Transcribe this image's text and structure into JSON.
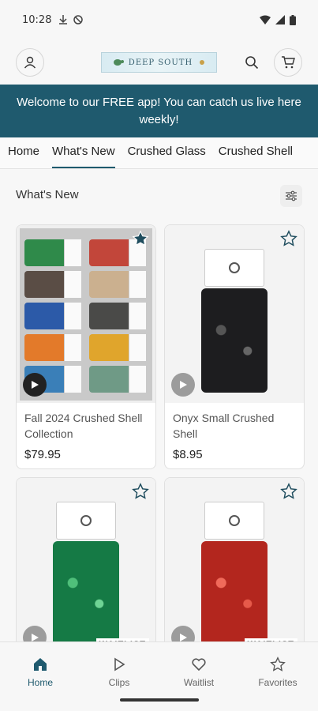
{
  "status_bar": {
    "time": "10:28"
  },
  "header": {
    "logo_text": "DEEP SOUTH"
  },
  "banner": {
    "text": "Welcome to our FREE app! You can catch us live here weekly!"
  },
  "tabs": [
    {
      "label": "Home",
      "active": false
    },
    {
      "label": "What's New",
      "active": true
    },
    {
      "label": "Crushed Glass",
      "active": false
    },
    {
      "label": "Crushed Shell",
      "active": false
    }
  ],
  "section": {
    "title": "What's New"
  },
  "products": [
    {
      "name": "Fall 2024 Crushed Shell Collection",
      "price": "$79.95",
      "favorited": true,
      "badge": ""
    },
    {
      "name": "Onyx Small Crushed Shell",
      "price": "$8.95",
      "favorited": false,
      "badge": ""
    },
    {
      "name": "",
      "price": "",
      "favorited": false,
      "badge": "WAITLIST"
    },
    {
      "name": "",
      "price": "",
      "favorited": false,
      "badge": "WAITLIST"
    }
  ],
  "bottom_nav": [
    {
      "label": "Home",
      "icon": "home-icon",
      "active": true
    },
    {
      "label": "Clips",
      "icon": "play-icon",
      "active": false
    },
    {
      "label": "Waitlist",
      "icon": "heart-icon",
      "active": false
    },
    {
      "label": "Favorites",
      "icon": "star-icon",
      "active": false
    }
  ],
  "colors": {
    "brand": "#1f5a6e",
    "active_tab": "#1f5a6e"
  }
}
